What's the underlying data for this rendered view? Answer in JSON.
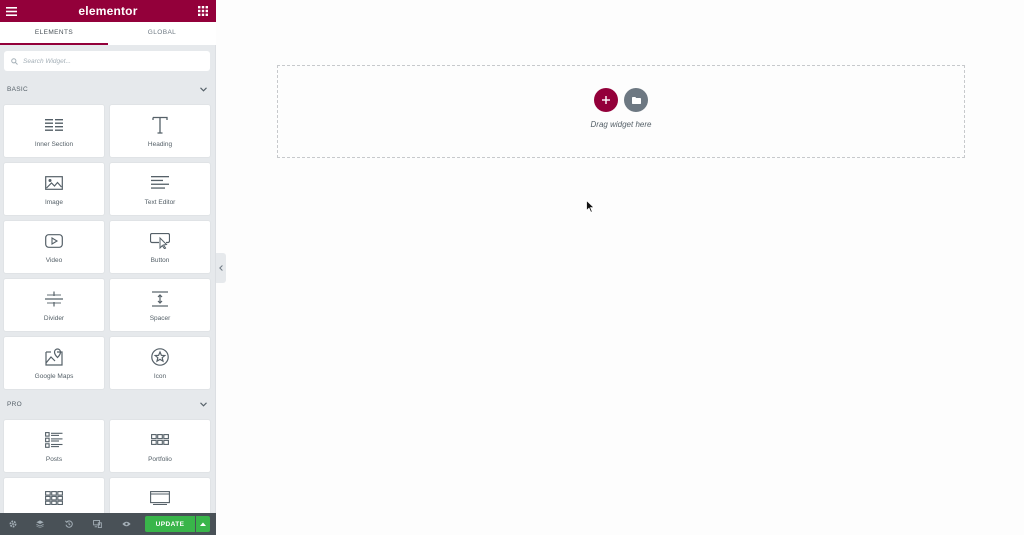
{
  "header": {
    "title": "elementor"
  },
  "tabs": [
    {
      "label": "ELEMENTS",
      "active": true
    },
    {
      "label": "GLOBAL",
      "active": false
    }
  ],
  "search": {
    "placeholder": "Search Widget..."
  },
  "categories": {
    "basic": {
      "title": "BASIC",
      "widgets": [
        {
          "label": "Inner Section",
          "icon": "inner-section-icon"
        },
        {
          "label": "Heading",
          "icon": "heading-icon"
        },
        {
          "label": "Image",
          "icon": "image-icon"
        },
        {
          "label": "Text Editor",
          "icon": "text-editor-icon"
        },
        {
          "label": "Video",
          "icon": "video-icon"
        },
        {
          "label": "Button",
          "icon": "button-icon"
        },
        {
          "label": "Divider",
          "icon": "divider-icon"
        },
        {
          "label": "Spacer",
          "icon": "spacer-icon"
        },
        {
          "label": "Google Maps",
          "icon": "google-maps-icon"
        },
        {
          "label": "Icon",
          "icon": "star-icon"
        }
      ]
    },
    "pro": {
      "title": "PRO",
      "widgets": [
        {
          "label": "Posts",
          "icon": "posts-icon"
        },
        {
          "label": "Portfolio",
          "icon": "portfolio-icon"
        },
        {
          "label": "",
          "icon": "gallery-icon"
        },
        {
          "label": "",
          "icon": "slides-icon"
        }
      ]
    }
  },
  "footer": {
    "buttons": [
      "settings-icon",
      "navigator-icon",
      "history-icon",
      "responsive-icon",
      "preview-icon"
    ],
    "update_label": "UPDATE"
  },
  "canvas": {
    "drop_text": "Drag widget here"
  },
  "colors": {
    "brand": "#93003a",
    "update": "#39b54a",
    "footer": "#495157",
    "panel": "#e6e9ec"
  }
}
